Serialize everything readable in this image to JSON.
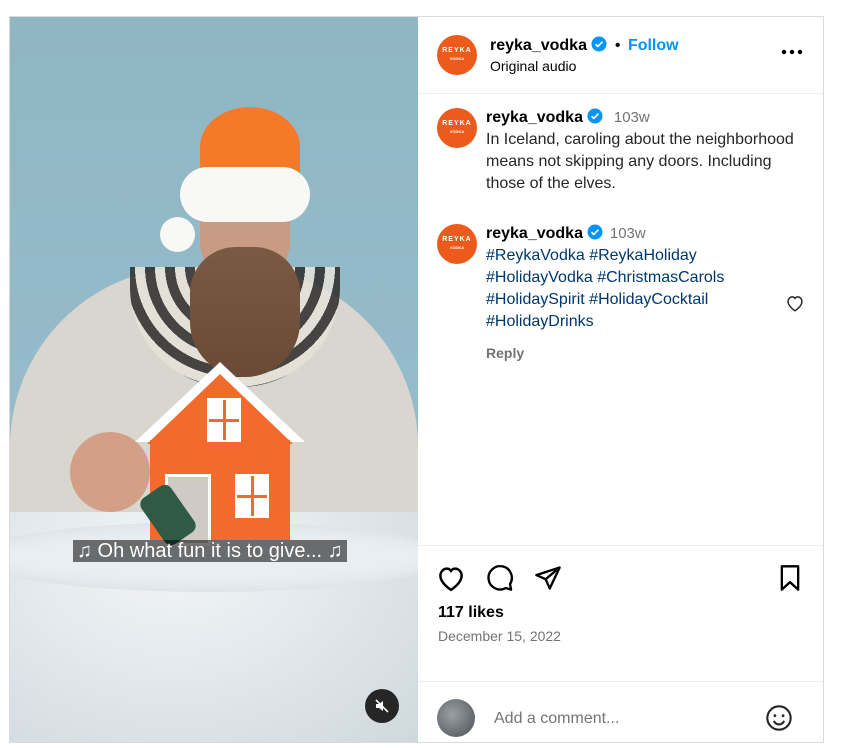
{
  "post": {
    "username": "reyka_vodka",
    "follow_label": "Follow",
    "separator": "•",
    "audio": "Original audio",
    "more_label": "•••",
    "avatar_text": "REYKA",
    "avatar_subtext": "VODKA"
  },
  "media": {
    "caption": "♫ Oh what fun it is to give... ♫"
  },
  "comments": [
    {
      "username": "reyka_vodka",
      "time": "103w",
      "text": "In Iceland, caroling about the neighborhood means not skipping any doors. Including those of the elves."
    },
    {
      "username": "reyka_vodka",
      "time": "103w",
      "hashtags": [
        "#ReykaVodka",
        "#ReykaHoliday",
        "#HolidayVodka",
        "#ChristmasCarols",
        "#HolidaySpirit",
        "#HolidayCocktail",
        "#HolidayDrinks"
      ],
      "reply_label": "Reply"
    }
  ],
  "actions": {
    "likes": "117 likes",
    "date": "December 15, 2022"
  },
  "add_comment": {
    "placeholder": "Add a comment..."
  },
  "colors": {
    "brand": "#ec5a1c",
    "link": "#0095f6",
    "hashtag": "#00376b",
    "muted": "#737373"
  }
}
